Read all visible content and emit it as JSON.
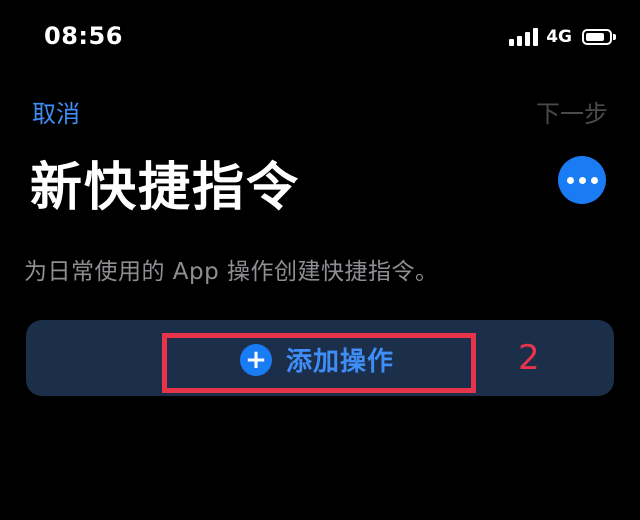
{
  "status_bar": {
    "time": "08:56",
    "network": "4G",
    "signal_bars": 4,
    "battery_level": 0.8
  },
  "nav": {
    "cancel_label": "取消",
    "next_label": "下一步"
  },
  "title": "新快捷指令",
  "more_icon": "ellipsis-icon",
  "description": "为日常使用的 App 操作创建快捷指令。",
  "add_action": {
    "icon": "plus-icon",
    "label": "添加操作"
  },
  "annotation": {
    "label": "2",
    "color": "#e8344a"
  },
  "colors": {
    "background": "#000000",
    "accent_blue": "#1a7cf5",
    "link_blue": "#3f8df7",
    "card_bg": "#1c2f4a",
    "disabled_gray": "#4a4a4c",
    "secondary_text": "#8e8e93"
  }
}
